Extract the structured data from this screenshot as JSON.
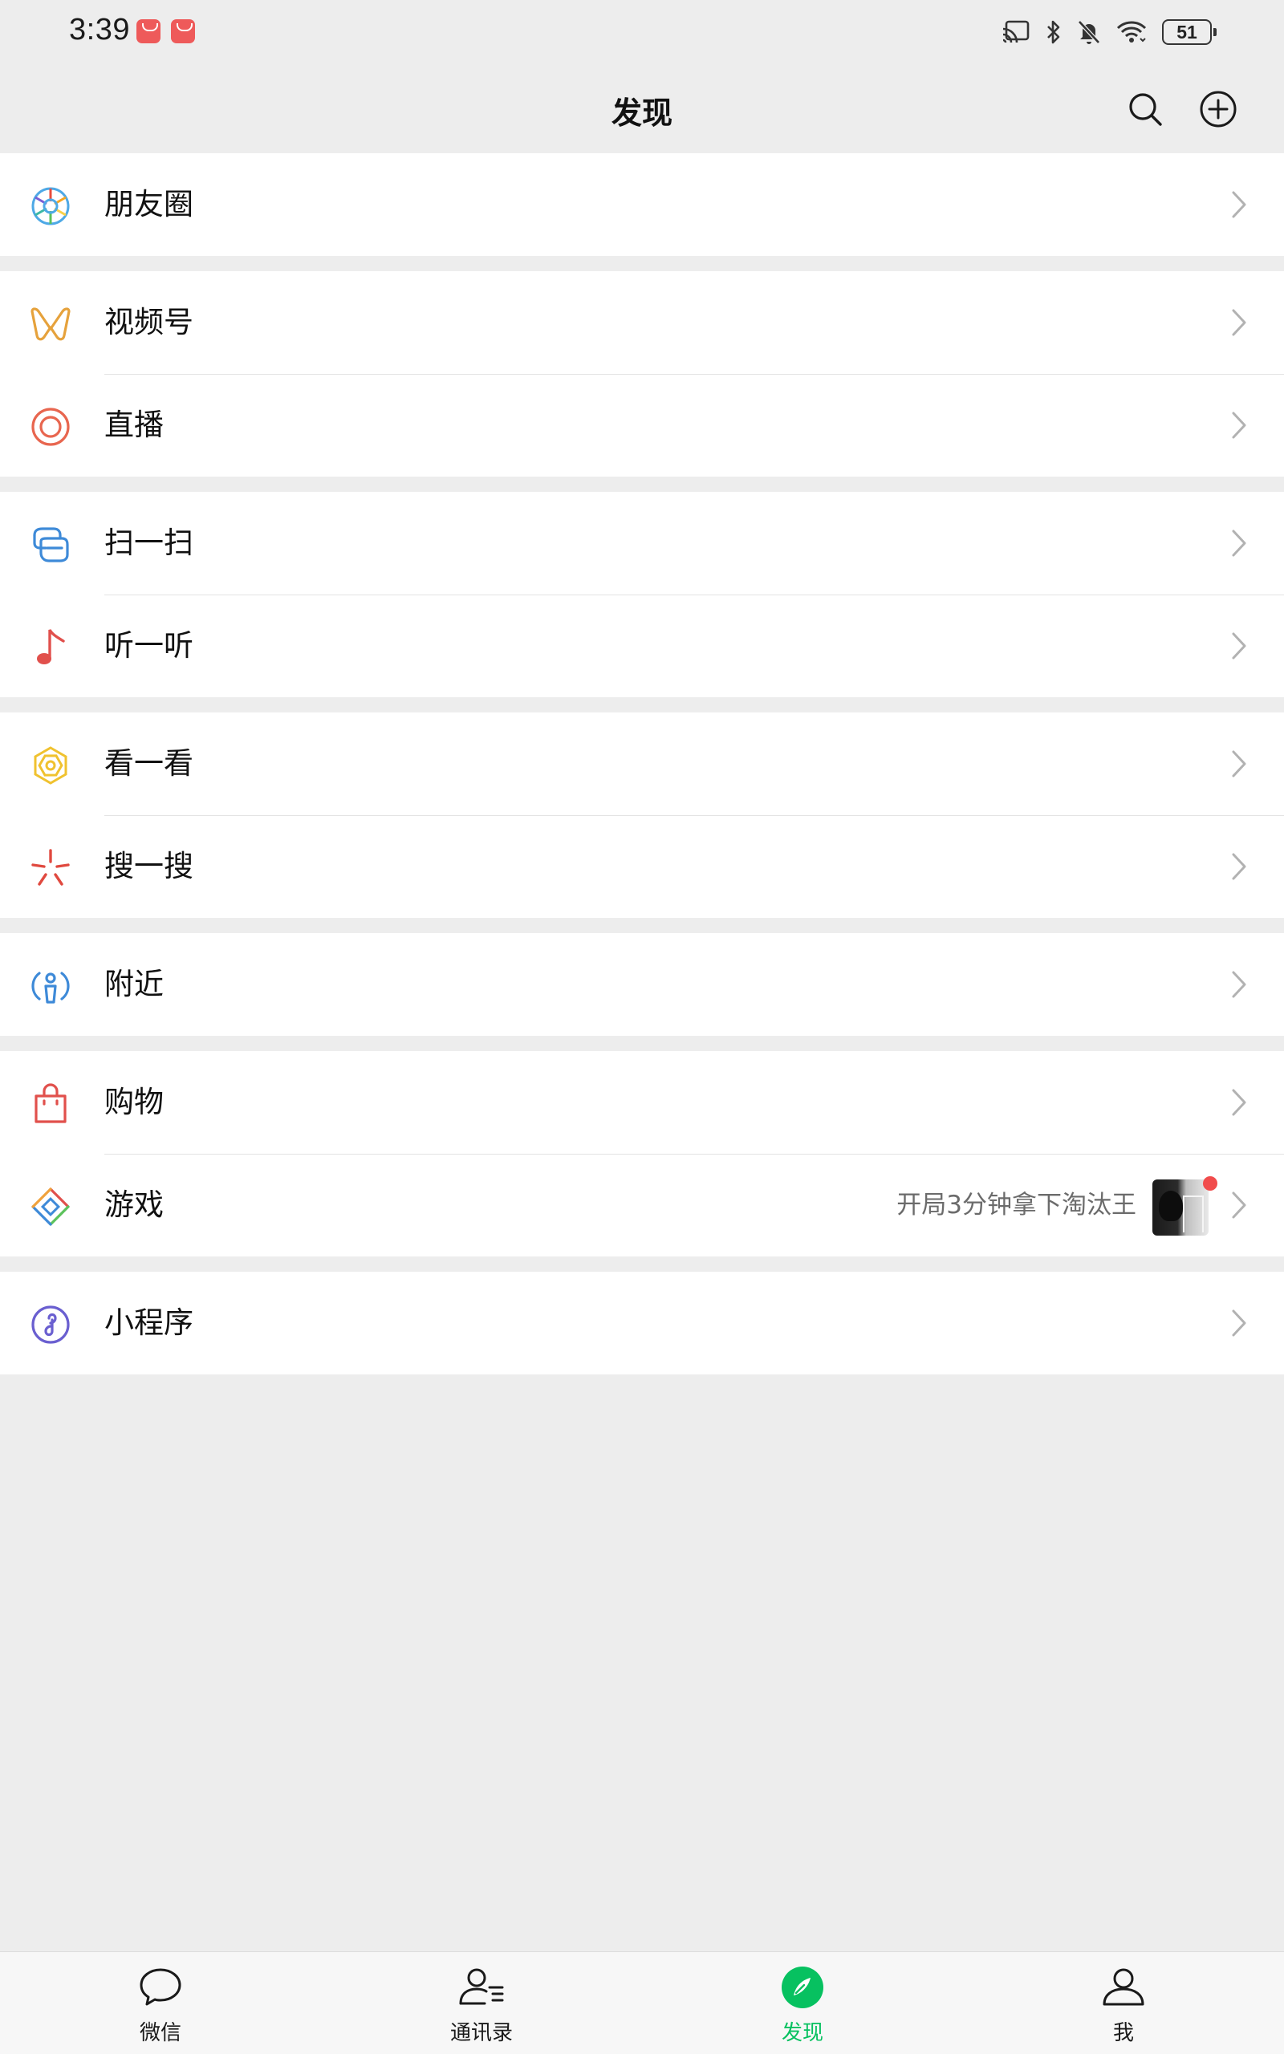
{
  "status_bar": {
    "time": "3:39",
    "battery": "51",
    "icons": [
      "cast-icon",
      "bluetooth-icon",
      "mute-bell-icon",
      "wifi-icon",
      "battery-icon"
    ]
  },
  "header": {
    "title": "发现"
  },
  "groups": [
    {
      "items": [
        {
          "label": "朋友圈",
          "icon": "moments-icon"
        }
      ]
    },
    {
      "items": [
        {
          "label": "视频号",
          "icon": "channels-icon"
        },
        {
          "label": "直播",
          "icon": "live-icon"
        }
      ]
    },
    {
      "items": [
        {
          "label": "扫一扫",
          "icon": "scan-icon"
        },
        {
          "label": "听一听",
          "icon": "music-note-icon"
        }
      ]
    },
    {
      "items": [
        {
          "label": "看一看",
          "icon": "top-stories-icon"
        },
        {
          "label": "搜一搜",
          "icon": "search-sparkle-icon"
        }
      ]
    },
    {
      "items": [
        {
          "label": "附近",
          "icon": "nearby-icon"
        }
      ]
    },
    {
      "items": [
        {
          "label": "购物",
          "icon": "shopping-bag-icon"
        },
        {
          "label": "游戏",
          "icon": "games-icon",
          "extra": "开局3分钟拿下淘汰王"
        }
      ]
    },
    {
      "items": [
        {
          "label": "小程序",
          "icon": "mini-programs-icon"
        }
      ]
    }
  ],
  "tabbar": {
    "tabs": [
      {
        "label": "微信",
        "icon": "chat-bubble-icon",
        "active": false
      },
      {
        "label": "通讯录",
        "icon": "contacts-icon",
        "active": false
      },
      {
        "label": "发现",
        "icon": "compass-icon",
        "active": true
      },
      {
        "label": "我",
        "icon": "person-icon",
        "active": false
      }
    ]
  },
  "colors": {
    "background": "#ededed",
    "accent_green": "#07c160",
    "badge_red": "#f14c4c"
  }
}
